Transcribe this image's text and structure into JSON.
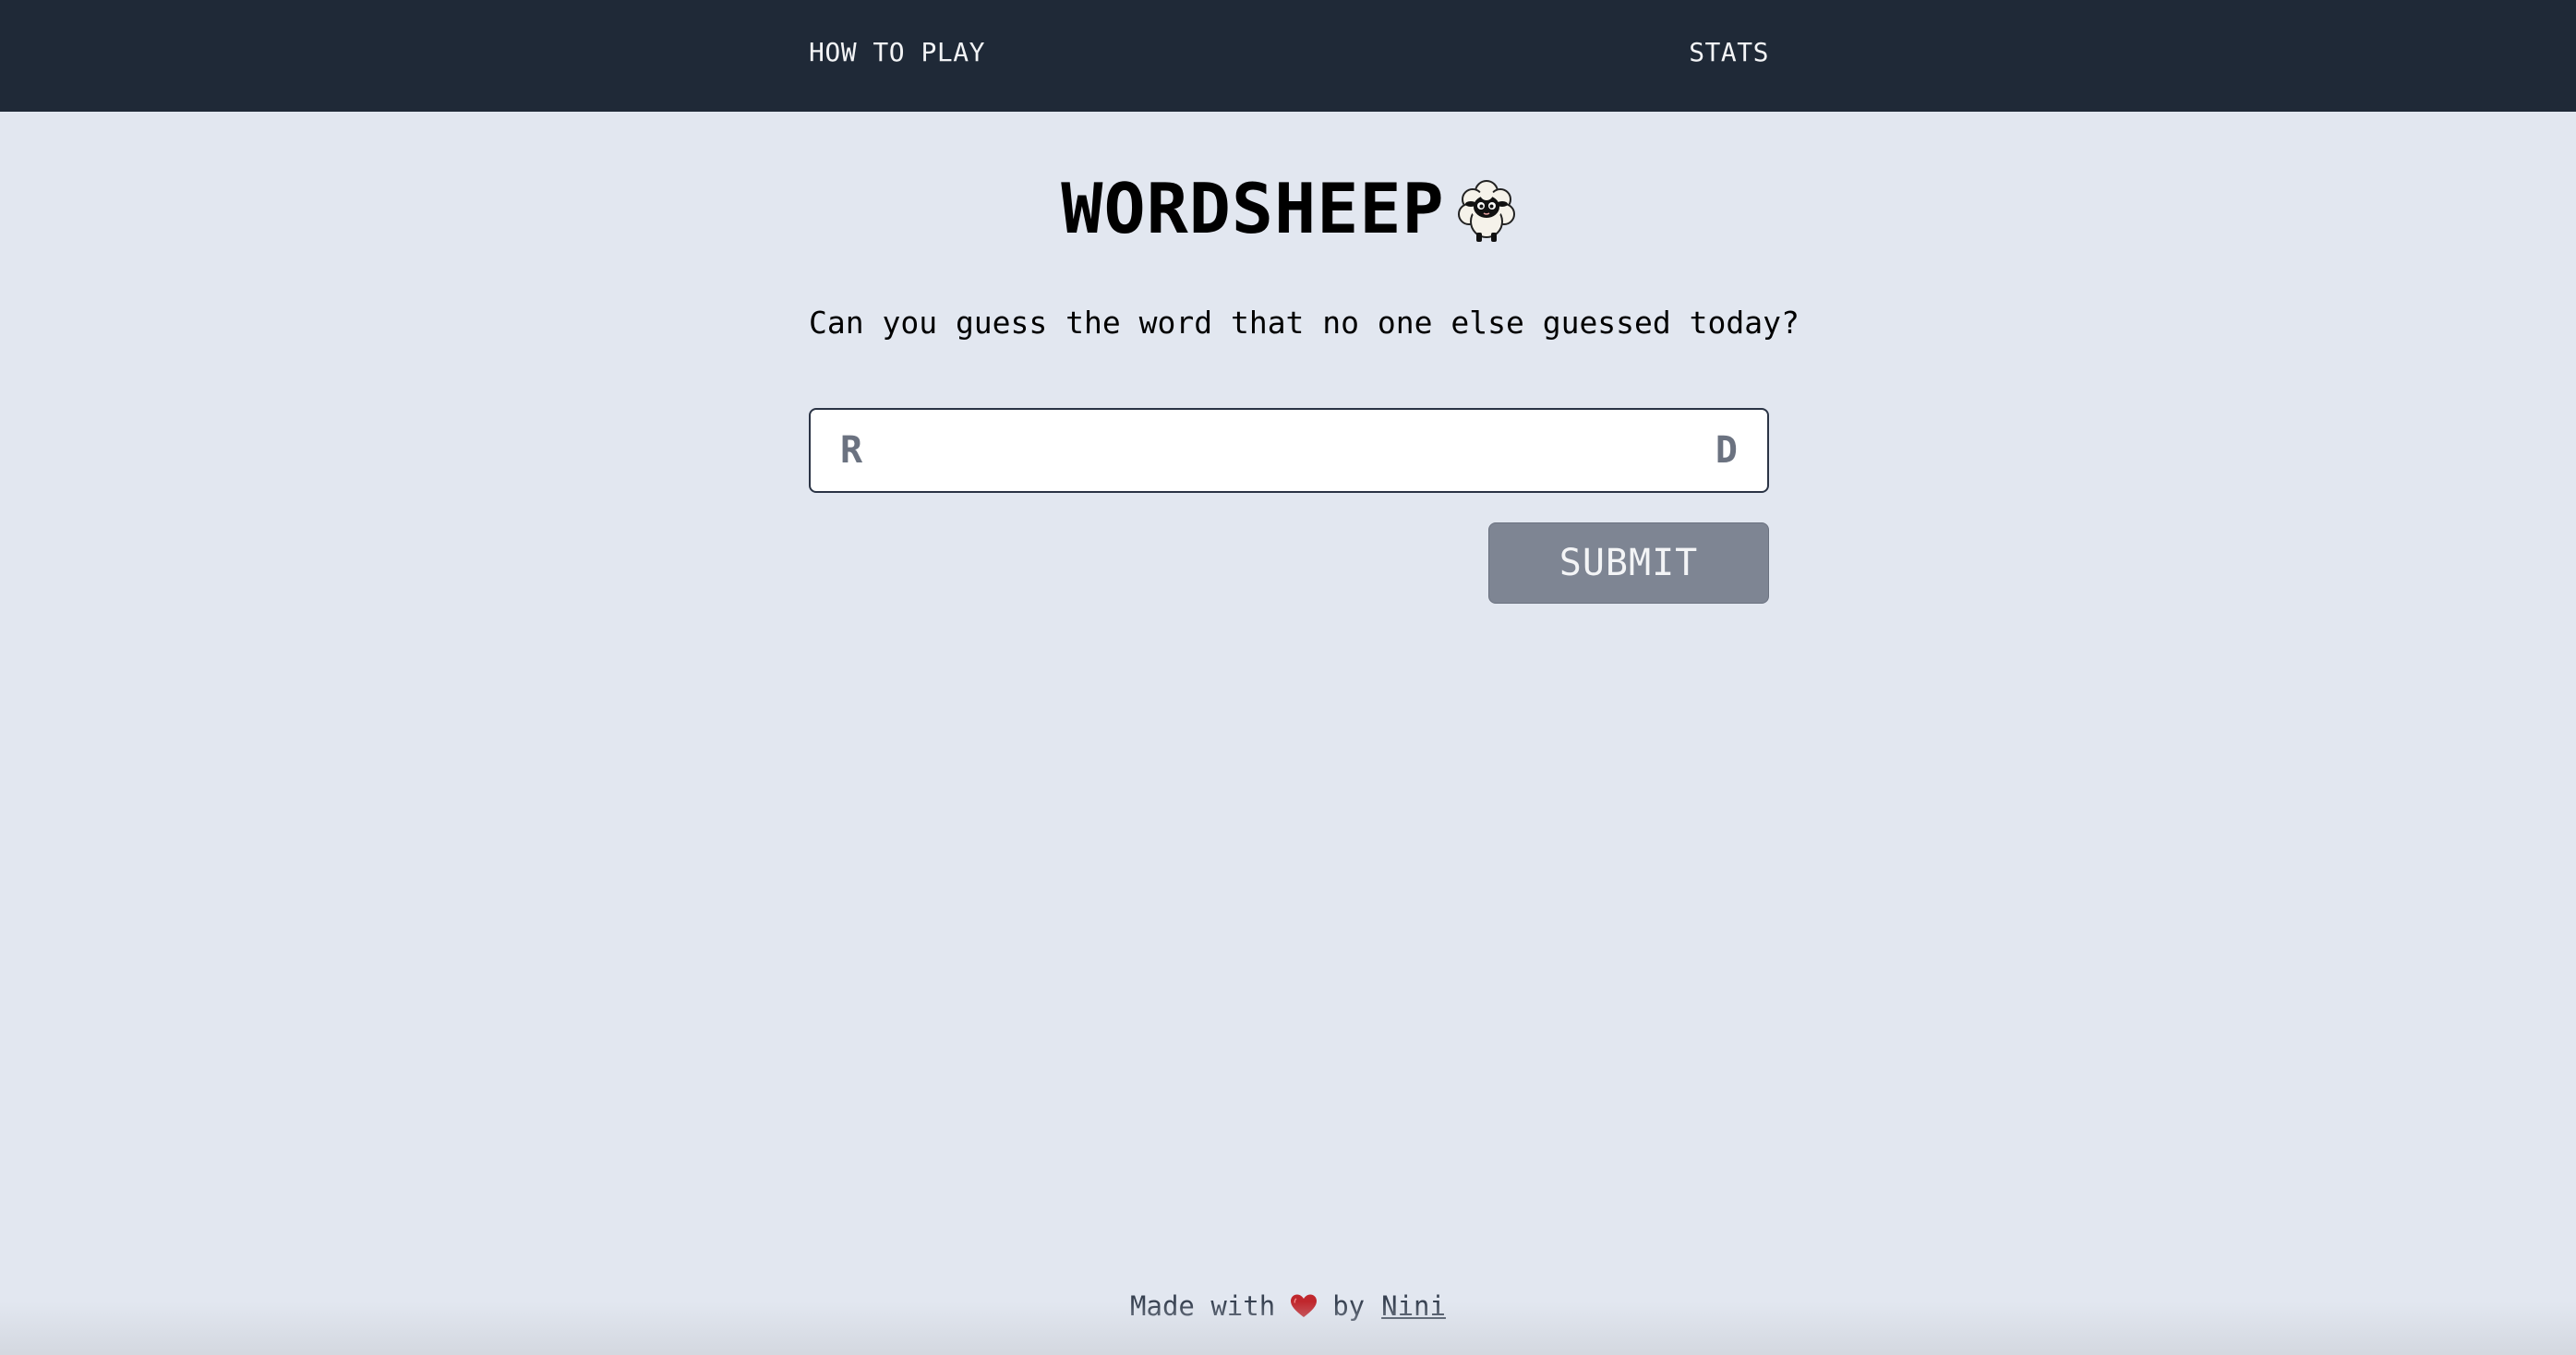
{
  "nav": {
    "how_to_play": "HOW TO PLAY",
    "stats": "STATS"
  },
  "header": {
    "title": "WORDSHEEP",
    "logo_icon": "sheep-icon"
  },
  "prompt": "Can you guess the word that no one else guessed today?",
  "guess": {
    "first_letter": "R",
    "last_letter": "D",
    "value": ""
  },
  "submit_label": "SUBMIT",
  "footer": {
    "made_with": "Made with",
    "heart_icon": "heart-icon",
    "by": "by",
    "author": "Nini"
  },
  "colors": {
    "topbar": "#1f2937",
    "background": "#e2e7f0",
    "submit_button": "#7e8593",
    "hint_letters": "#6b7280",
    "heart": "#c0272d"
  }
}
